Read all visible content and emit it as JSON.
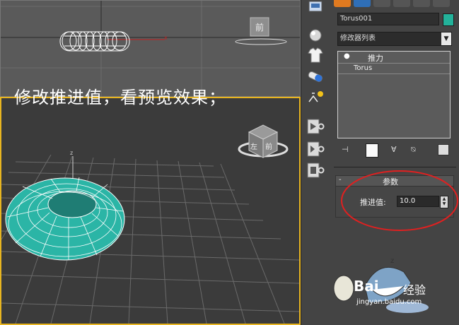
{
  "caption": "修改推进值，看预览效果；",
  "viewports": {
    "top": {
      "viewcube_face": "前"
    },
    "perspective": {
      "viewcube_faces": [
        "左",
        "前"
      ],
      "axis_label": "z"
    }
  },
  "command_panel": {
    "object_name": "Torus001",
    "object_color": "#23b29a",
    "modifier_list": "修改器列表",
    "stack_items": [
      "推力",
      "Torus"
    ],
    "rollout_title": "参数",
    "rollout_minus": "-",
    "param_label": "推进值:",
    "param_value": "10.0"
  },
  "watermark": {
    "brand": "Bai",
    "brand2": "经验",
    "url": "jingyan.baidu.com"
  },
  "colors": {
    "torus": "#2bb5a6",
    "highlight_ring": "#e02020",
    "active_border": "#e8b520"
  }
}
